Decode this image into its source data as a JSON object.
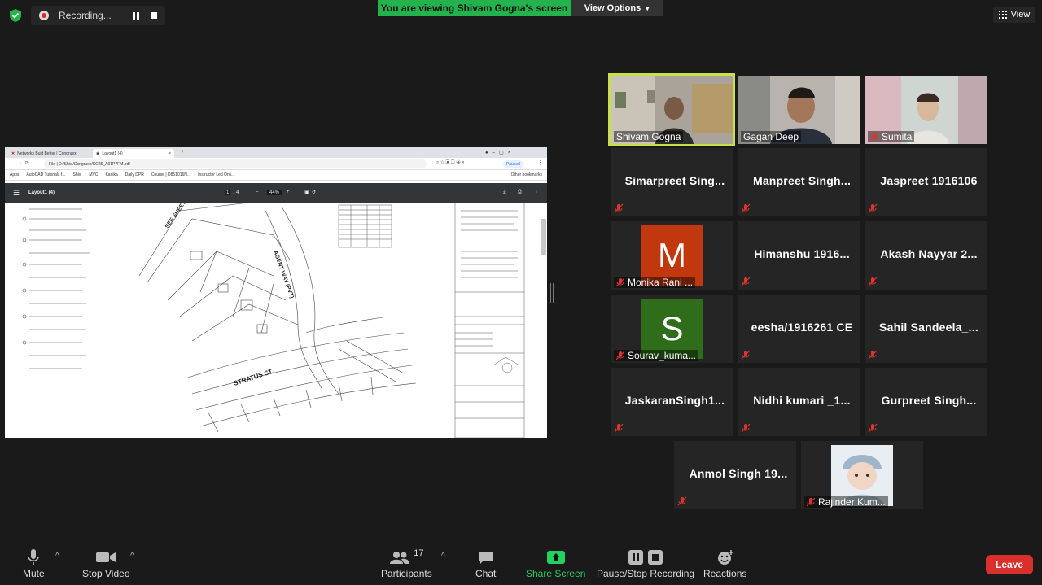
{
  "top": {
    "recording_label": "Recording...",
    "viewing_banner": "You are viewing Shivam Gogna's screen",
    "view_options": "View Options",
    "view_label": "View"
  },
  "shared": {
    "tabs": [
      "Networks Built Better | Congruex",
      "Layout1 (4)"
    ],
    "url": "File | D:/Shivi/Congruex/KC25_A01P7FM.pdf",
    "paused": "Paused",
    "bookmarks": [
      "Apps",
      "AutoCAD Tutorials f...",
      "Shivi",
      "MVC",
      "Kanika",
      "Daily DPR",
      "Course | D851016N...",
      "Instructor Led Onli..."
    ],
    "other_bookmarks": "Other bookmarks",
    "pdf_title": "Layout1 (4)",
    "page_current": "1",
    "page_total": "4",
    "zoom": "44%",
    "drawing_labels": [
      "STRATUS ST.",
      "SEE SHEET",
      "AGENT WAY (PVT)"
    ]
  },
  "participants": [
    {
      "name": "Shivam Gogna",
      "type": "video",
      "selected": true
    },
    {
      "name": "Gagan Deep",
      "type": "video"
    },
    {
      "name": "Sumita",
      "type": "video",
      "muted": true
    },
    {
      "name": "Simarpreet  Sing...",
      "type": "name",
      "muted": true
    },
    {
      "name": "Manpreet  Singh...",
      "type": "name",
      "muted": true
    },
    {
      "name": "Jaspreet 1916106",
      "type": "name",
      "muted": true
    },
    {
      "name": "Monika Rani ...",
      "type": "avatar",
      "initial": "M",
      "color": "#c2380e",
      "muted": true
    },
    {
      "name": "Himanshu  1916...",
      "type": "name",
      "muted": true
    },
    {
      "name": "Akash  Nayyar  2...",
      "type": "name",
      "muted": true
    },
    {
      "name": "Sourav_kuma...",
      "type": "avatar",
      "initial": "S",
      "color": "#2f6d1b",
      "muted": true
    },
    {
      "name": "eesha/1916261 CE",
      "type": "name",
      "muted": true
    },
    {
      "name": "Sahil  Sandeela_...",
      "type": "name",
      "muted": true
    },
    {
      "name": "JaskaranSingh1...",
      "type": "name",
      "muted": true
    },
    {
      "name": "Nidhi  kumari  _1...",
      "type": "name",
      "muted": true
    },
    {
      "name": "Gurpreet  Singh...",
      "type": "name",
      "muted": true
    },
    {
      "name": "Anmol Singh  19...",
      "type": "name",
      "muted": true
    },
    {
      "name": "Rajinder Kum...",
      "type": "photo",
      "muted": true
    }
  ],
  "toolbar": {
    "mute": "Mute",
    "stop_video": "Stop Video",
    "participants": "Participants",
    "participants_count": "17",
    "chat": "Chat",
    "share_screen": "Share Screen",
    "recording": "Pause/Stop Recording",
    "reactions": "Reactions",
    "leave": "Leave"
  },
  "colors": {
    "banner_green": "#23b24b",
    "share_green": "#23d160",
    "leave_red": "#d9302b",
    "selected_outline": "#c8e04a"
  }
}
